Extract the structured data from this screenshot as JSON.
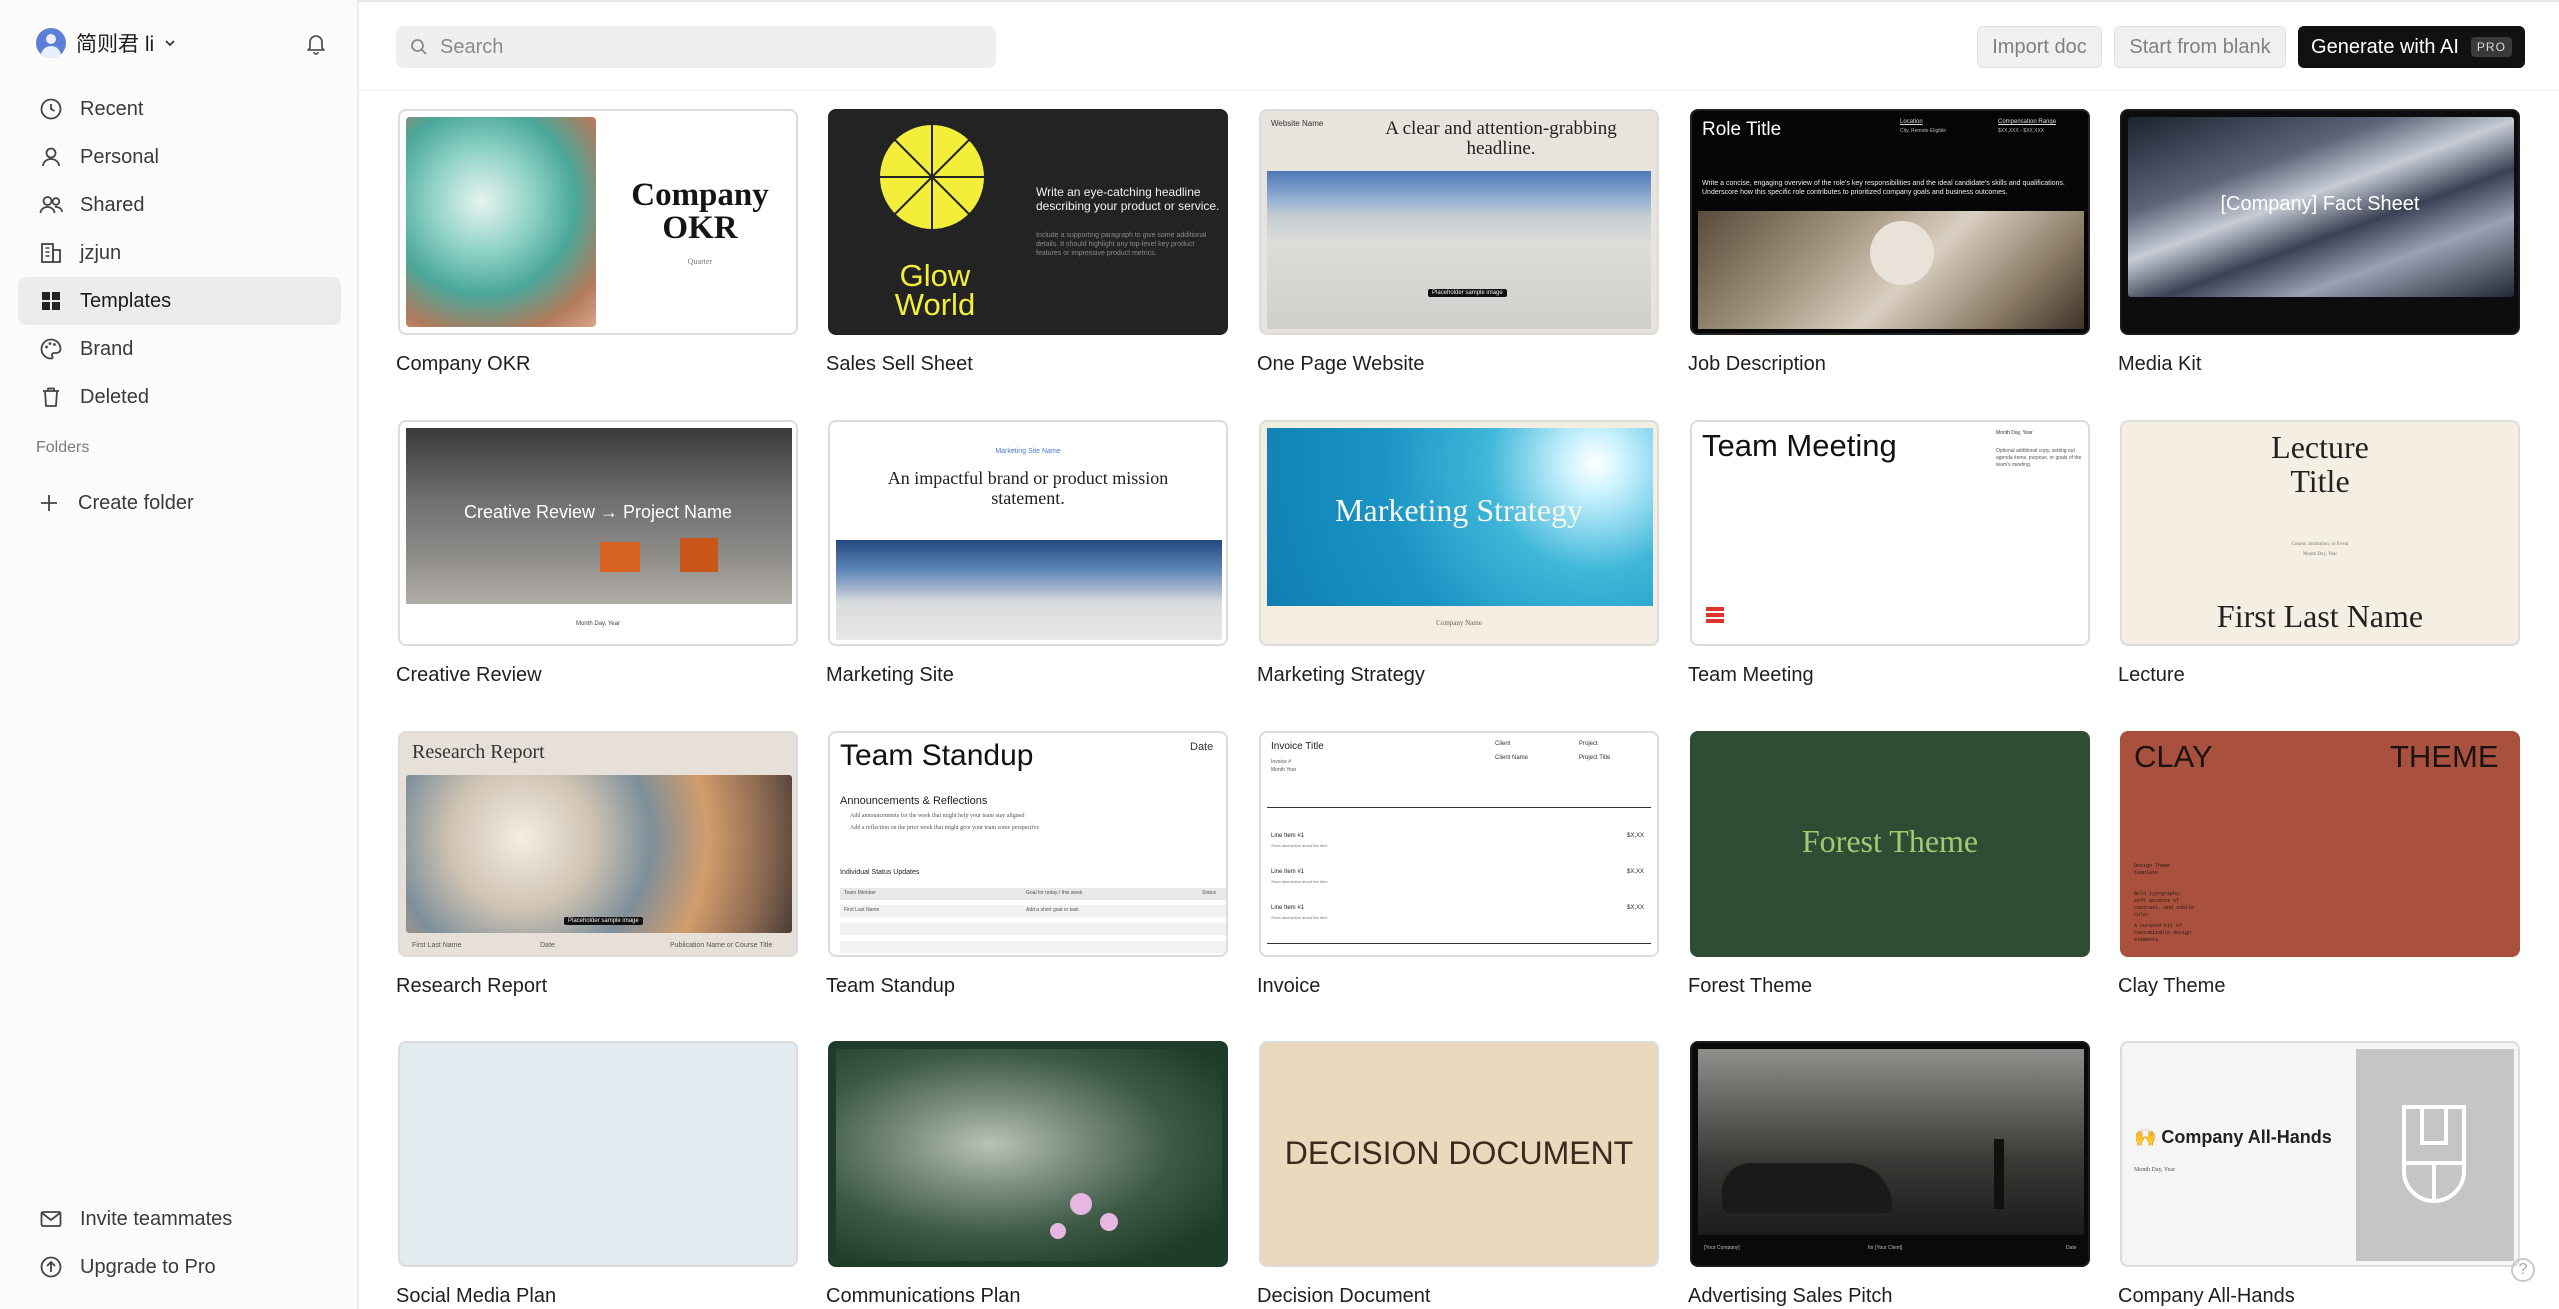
{
  "user": {
    "name": "简则君 li"
  },
  "sidebar": {
    "items": [
      {
        "label": "Recent",
        "icon": "clock-icon"
      },
      {
        "label": "Personal",
        "icon": "person-icon"
      },
      {
        "label": "Shared",
        "icon": "people-icon"
      },
      {
        "label": "jzjun",
        "icon": "building-icon"
      },
      {
        "label": "Templates",
        "icon": "grid-icon",
        "active": true
      },
      {
        "label": "Brand",
        "icon": "palette-icon"
      },
      {
        "label": "Deleted",
        "icon": "trash-icon"
      }
    ],
    "folders_label": "Folders",
    "create_folder": "Create folder",
    "invite": "Invite teammates",
    "upgrade": "Upgrade to Pro"
  },
  "search": {
    "placeholder": "Search"
  },
  "toolbar": {
    "import_label": "Import doc",
    "blank_label": "Start from blank",
    "ai_label": "Generate with AI",
    "pro_badge": "PRO"
  },
  "help": "?",
  "templates": [
    {
      "label": "Company OKR",
      "t1": "Company",
      "t2": "OKR",
      "t3": "Quarter"
    },
    {
      "label": "Sales Sell Sheet",
      "t1": "Glow",
      "t2": "World",
      "t3": "Write an eye-catching headline describing your product or service.",
      "t4": "Include a supporting paragraph to give some additional details. It should highlight any top-level key product features or impressive product metrics."
    },
    {
      "label": "One Page Website",
      "t1": "Website Name",
      "t2": "A clear and attention-grabbing headline.",
      "t3": "Placeholder sample image"
    },
    {
      "label": "Job Description",
      "t1": "Role Title",
      "t2": "Write a concise, engaging overview of the role's key responsibilities and the ideal candidate's skills and qualifications. Underscore how this specific role contributes to prioritized company goals and business outcomes.",
      "t3": "Location",
      "t4": "Compensation Range",
      "t5": "City, Remote Eligible",
      "t6": "$XX,XXX - $XX,XXX"
    },
    {
      "label": "Media Kit",
      "t1": "[Company] Fact Sheet"
    },
    {
      "label": "Creative Review",
      "t1": "Creative Review → Project Name",
      "t2": "Month Day, Year"
    },
    {
      "label": "Marketing Site",
      "t1": "Marketing Site Name",
      "t2": "An impactful brand or product mission statement."
    },
    {
      "label": "Marketing Strategy",
      "t1": "Marketing Strategy",
      "t2": "Company Name"
    },
    {
      "label": "Team Meeting",
      "t1": "Team Meeting",
      "t2": "Month Day, Year",
      "t3": "Optional additional copy, setting out agenda items, purpose, or goals of the team's meeting."
    },
    {
      "label": "Lecture",
      "t1": "Lecture",
      "t2": "Title",
      "t3": "Course, Institution, or Event",
      "t4": "Month Day, Year",
      "t5": "First Last Name"
    },
    {
      "label": "Research Report",
      "t1": "Research Report",
      "t2": "Placeholder sample image",
      "t3": "First Last Name",
      "t4": "Date",
      "t5": "Publication Name or Course Title"
    },
    {
      "label": "Team Standup",
      "t1": "Team Standup",
      "t2": "Date",
      "t3": "Announcements & Reflections",
      "t4": "Add announcements for the week that might help your team stay aligned",
      "t5": "Add a reflection on the prior week that might give your team some perspective",
      "t6": "Individual Status Updates",
      "t7": "Team Member",
      "t8": "Goal for today / this week",
      "t9": "Status",
      "t10": "First Last Name",
      "t11": "Add a short goal or task"
    },
    {
      "label": "Invoice",
      "t1": "Invoice Title",
      "t2": "Client",
      "t3": "Project",
      "t4": "Client Name",
      "t5": "Project Title",
      "t6": "Invoice #",
      "t7": "Month Year",
      "t8": "Line Item #1",
      "t9": "Short description about the item",
      "t10": "$X,XX"
    },
    {
      "label": "Forest Theme",
      "t1": "Forest Theme"
    },
    {
      "label": "Clay Theme",
      "t1": "CLAY",
      "t2": "THEME",
      "t3": "Design Theme template",
      "t4": "Bold typography, soft accents of contrast, and subtle color",
      "t5": "A curated kit of customizable design elements"
    },
    {
      "label": "Social Media Plan"
    },
    {
      "label": "Communications Plan"
    },
    {
      "label": "Decision Document",
      "t1": "DECISION DOCUMENT"
    },
    {
      "label": "Advertising Sales Pitch",
      "t1": "[Your Company]",
      "t2": "for [Your Client]",
      "t3": "Date"
    },
    {
      "label": "Company All-Hands",
      "t1": "🙌 Company All-Hands",
      "t2": "Month Day, Year"
    }
  ],
  "colors": {
    "accent_dark": "#111111",
    "active_nav": "#ebebeb",
    "forest": "#2f4d34",
    "forest_text": "#a6c873",
    "clay": "#a9503f",
    "decision_bg": "#ead9bd",
    "glow_yellow": "#f2ee3a",
    "avatar": "#5b7fd6"
  }
}
